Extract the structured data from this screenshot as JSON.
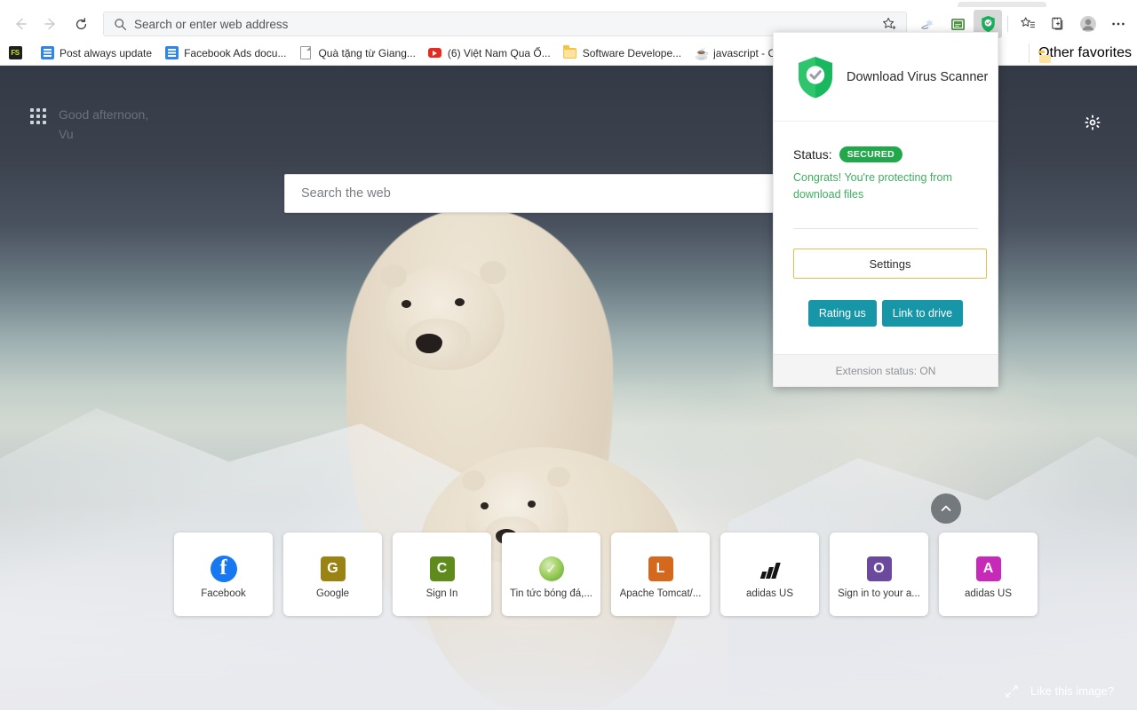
{
  "browser": {
    "nav": {
      "back_icon": "back-arrow-icon",
      "forward_icon": "forward-arrow-icon",
      "reload_icon": "reload-icon"
    },
    "omnibox": {
      "placeholder": "Search or enter web address",
      "value": "",
      "search_icon": "magnifier-icon",
      "favorite_icon": "star-outline-icon"
    },
    "toolbar_icons": [
      {
        "name": "immersive-reader-icon"
      },
      {
        "name": "green-extension-icon"
      },
      {
        "name": "virus-scanner-shield-icon",
        "active": true
      },
      {
        "name": "favorites-icon"
      },
      {
        "name": "collections-icon"
      },
      {
        "name": "profile-avatar-icon"
      },
      {
        "name": "settings-and-more-icon"
      }
    ]
  },
  "bookmarks": {
    "items": [
      {
        "label": "",
        "icon": "fs-icon"
      },
      {
        "label": "Post always update",
        "icon": "doc-blue-icon"
      },
      {
        "label": "Facebook Ads docu...",
        "icon": "doc-blue-icon"
      },
      {
        "label": "Quà tặng từ Giang...",
        "icon": "page-icon"
      },
      {
        "label": "(6) Việt Nam Qua Ố...",
        "icon": "youtube-icon"
      },
      {
        "label": "Software Develope...",
        "icon": "folder-icon"
      },
      {
        "label": "javascript - Compo...",
        "icon": "java-icon"
      }
    ],
    "other_favorites": {
      "label": "Other favorites",
      "icon": "folder-icon"
    }
  },
  "newtab": {
    "greeting_line1": "Good afternoon,",
    "greeting_line2": "Vu",
    "apps_icon": "app-grid-icon",
    "page_settings_icon": "gear-icon",
    "search": {
      "placeholder": "Search the web"
    },
    "scroll_up_icon": "chevron-up-icon",
    "like_image": {
      "label": "Like this image?",
      "icon": "expand-diagonal-icon"
    },
    "tiles": [
      {
        "label": "Facebook",
        "icon": "facebook-icon",
        "glyph": "f",
        "color": "#1778f2",
        "style": "circle"
      },
      {
        "label": "Google",
        "icon": "letter-tile-icon",
        "glyph": "G",
        "color": "#9a8312",
        "style": "square"
      },
      {
        "label": "Sign In",
        "icon": "letter-tile-icon",
        "glyph": "C",
        "color": "#5f8a1c",
        "style": "square"
      },
      {
        "label": "Tin tức bóng đá,...",
        "icon": "green-ball-icon",
        "glyph": "✓",
        "color": "#79b83c",
        "style": "circle-green"
      },
      {
        "label": "Apache Tomcat/...",
        "icon": "letter-tile-icon",
        "glyph": "L",
        "color": "#d4691e",
        "style": "square"
      },
      {
        "label": "adidas US",
        "icon": "adidas-logo-icon",
        "glyph": "",
        "color": "#141414",
        "style": "adidas"
      },
      {
        "label": "Sign in to your a...",
        "icon": "letter-tile-icon",
        "glyph": "O",
        "color": "#6b4a9e",
        "style": "square"
      },
      {
        "label": "adidas US",
        "icon": "letter-tile-icon",
        "glyph": "A",
        "color": "#c72ab8",
        "style": "square"
      }
    ]
  },
  "popup": {
    "title": "Download Virus Scanner",
    "shield_icon": "shield-check-icon",
    "status_label": "Status:",
    "status_badge": "SECURED",
    "status_badge_color": "#21a84a",
    "status_description": "Congrats! You're protecting from download files",
    "settings_button": "Settings",
    "rating_button": "Rating us",
    "link_drive_button": "Link to drive",
    "footer": "Extension status: ON",
    "accent_teal": "#1796a8",
    "accent_gold": "#e3bf4e"
  }
}
